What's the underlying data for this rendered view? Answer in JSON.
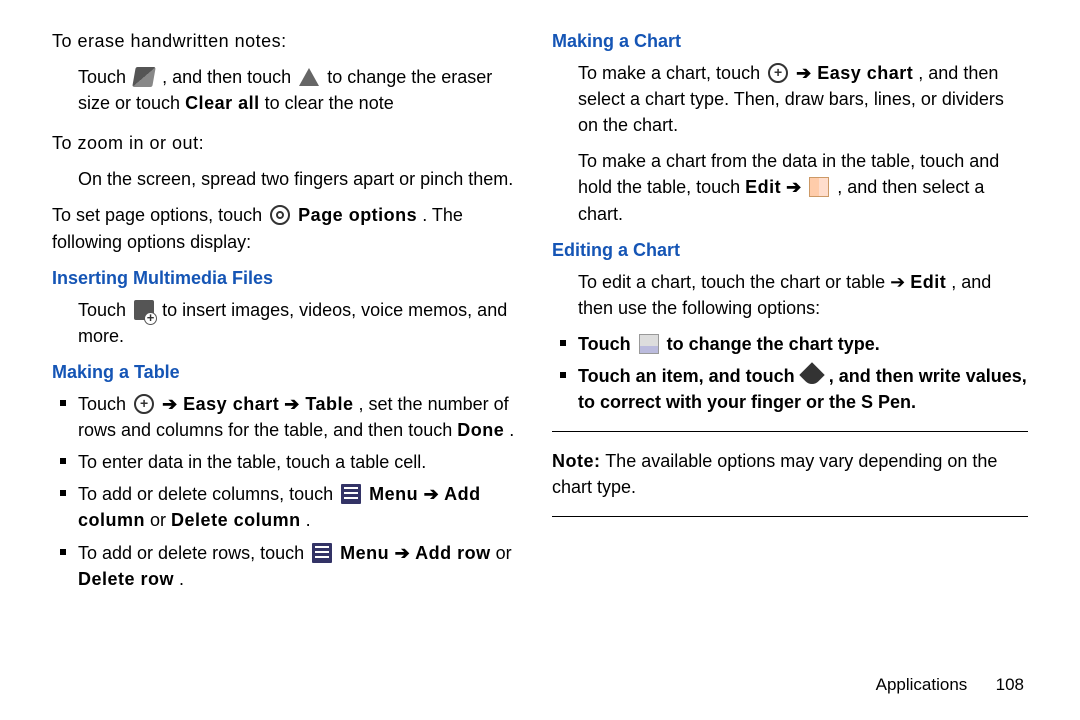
{
  "left": {
    "erase_heading": "To erase handwritten notes:",
    "erase_p1a": "Touch ",
    "erase_p1b": ", and then touch ",
    "erase_p1c": " to change the eraser size or touch ",
    "erase_p1d": "Clear all",
    "erase_p1e": " to clear the note",
    "zoom_heading": "To zoom in or out:",
    "zoom_p": "On the screen, spread two fingers apart or pinch them.",
    "pageopt_a": "To set page options, touch ",
    "pageopt_b": " Page options",
    "pageopt_c": ". The following options display:",
    "h_insert": "Inserting Multimedia Files",
    "insert_a": "Touch ",
    "insert_b": " to insert images, videos, voice memos, and more.",
    "h_table": "Making a Table",
    "tbl1_a": "Touch ",
    "tbl1_arrow": " ➔ ",
    "tbl1_b": "Easy chart",
    "tbl1_c": " ➔ ",
    "tbl1_d": "Table",
    "tbl1_e": ", set the number of rows and columns for the table, and then touch ",
    "tbl1_f": "Done",
    "tbl1_g": ".",
    "tbl2": "To enter data in the table, touch a table cell.",
    "tbl3_a": "To add or delete columns, touch ",
    "tbl3_b": " Menu ➔ ",
    "tbl3_c": "Add column",
    "tbl3_d": " or ",
    "tbl3_e": "Delete column",
    "tbl3_f": ".",
    "tbl4_a": "To add or delete rows, touch ",
    "tbl4_b": " Menu ➔ ",
    "tbl4_c": "Add row",
    "tbl4_d": " or ",
    "tbl4_e": "Delete row",
    "tbl4_f": "."
  },
  "right": {
    "h_chart": "Making a Chart",
    "chart_a": "To make a chart, touch ",
    "chart_arrow": " ➔ ",
    "chart_b": "Easy chart",
    "chart_c": ", and then select a chart type. Then, draw bars, lines, or dividers on the chart.",
    "chart2_a": "To make a chart from the data in the table, touch and hold the table, touch ",
    "chart2_b": "Edit",
    "chart2_c": " ➔ ",
    "chart2_d": ", and then select a chart.",
    "h_edit": "Editing a Chart",
    "edit_a": "To edit a chart, touch the chart or table ➔ ",
    "edit_b": "Edit",
    "edit_c": ", and then use the following options:",
    "opt1_a": "Touch ",
    "opt1_b": " to change the chart type.",
    "opt2": "Touch an item, and touch ",
    "opt2b": ", and then write values, to correct with your finger or the S Pen.",
    "note_label": "Note:",
    "note_text": " The available options may vary depending on the chart type."
  },
  "footer": {
    "section": "Applications",
    "page": "108"
  }
}
